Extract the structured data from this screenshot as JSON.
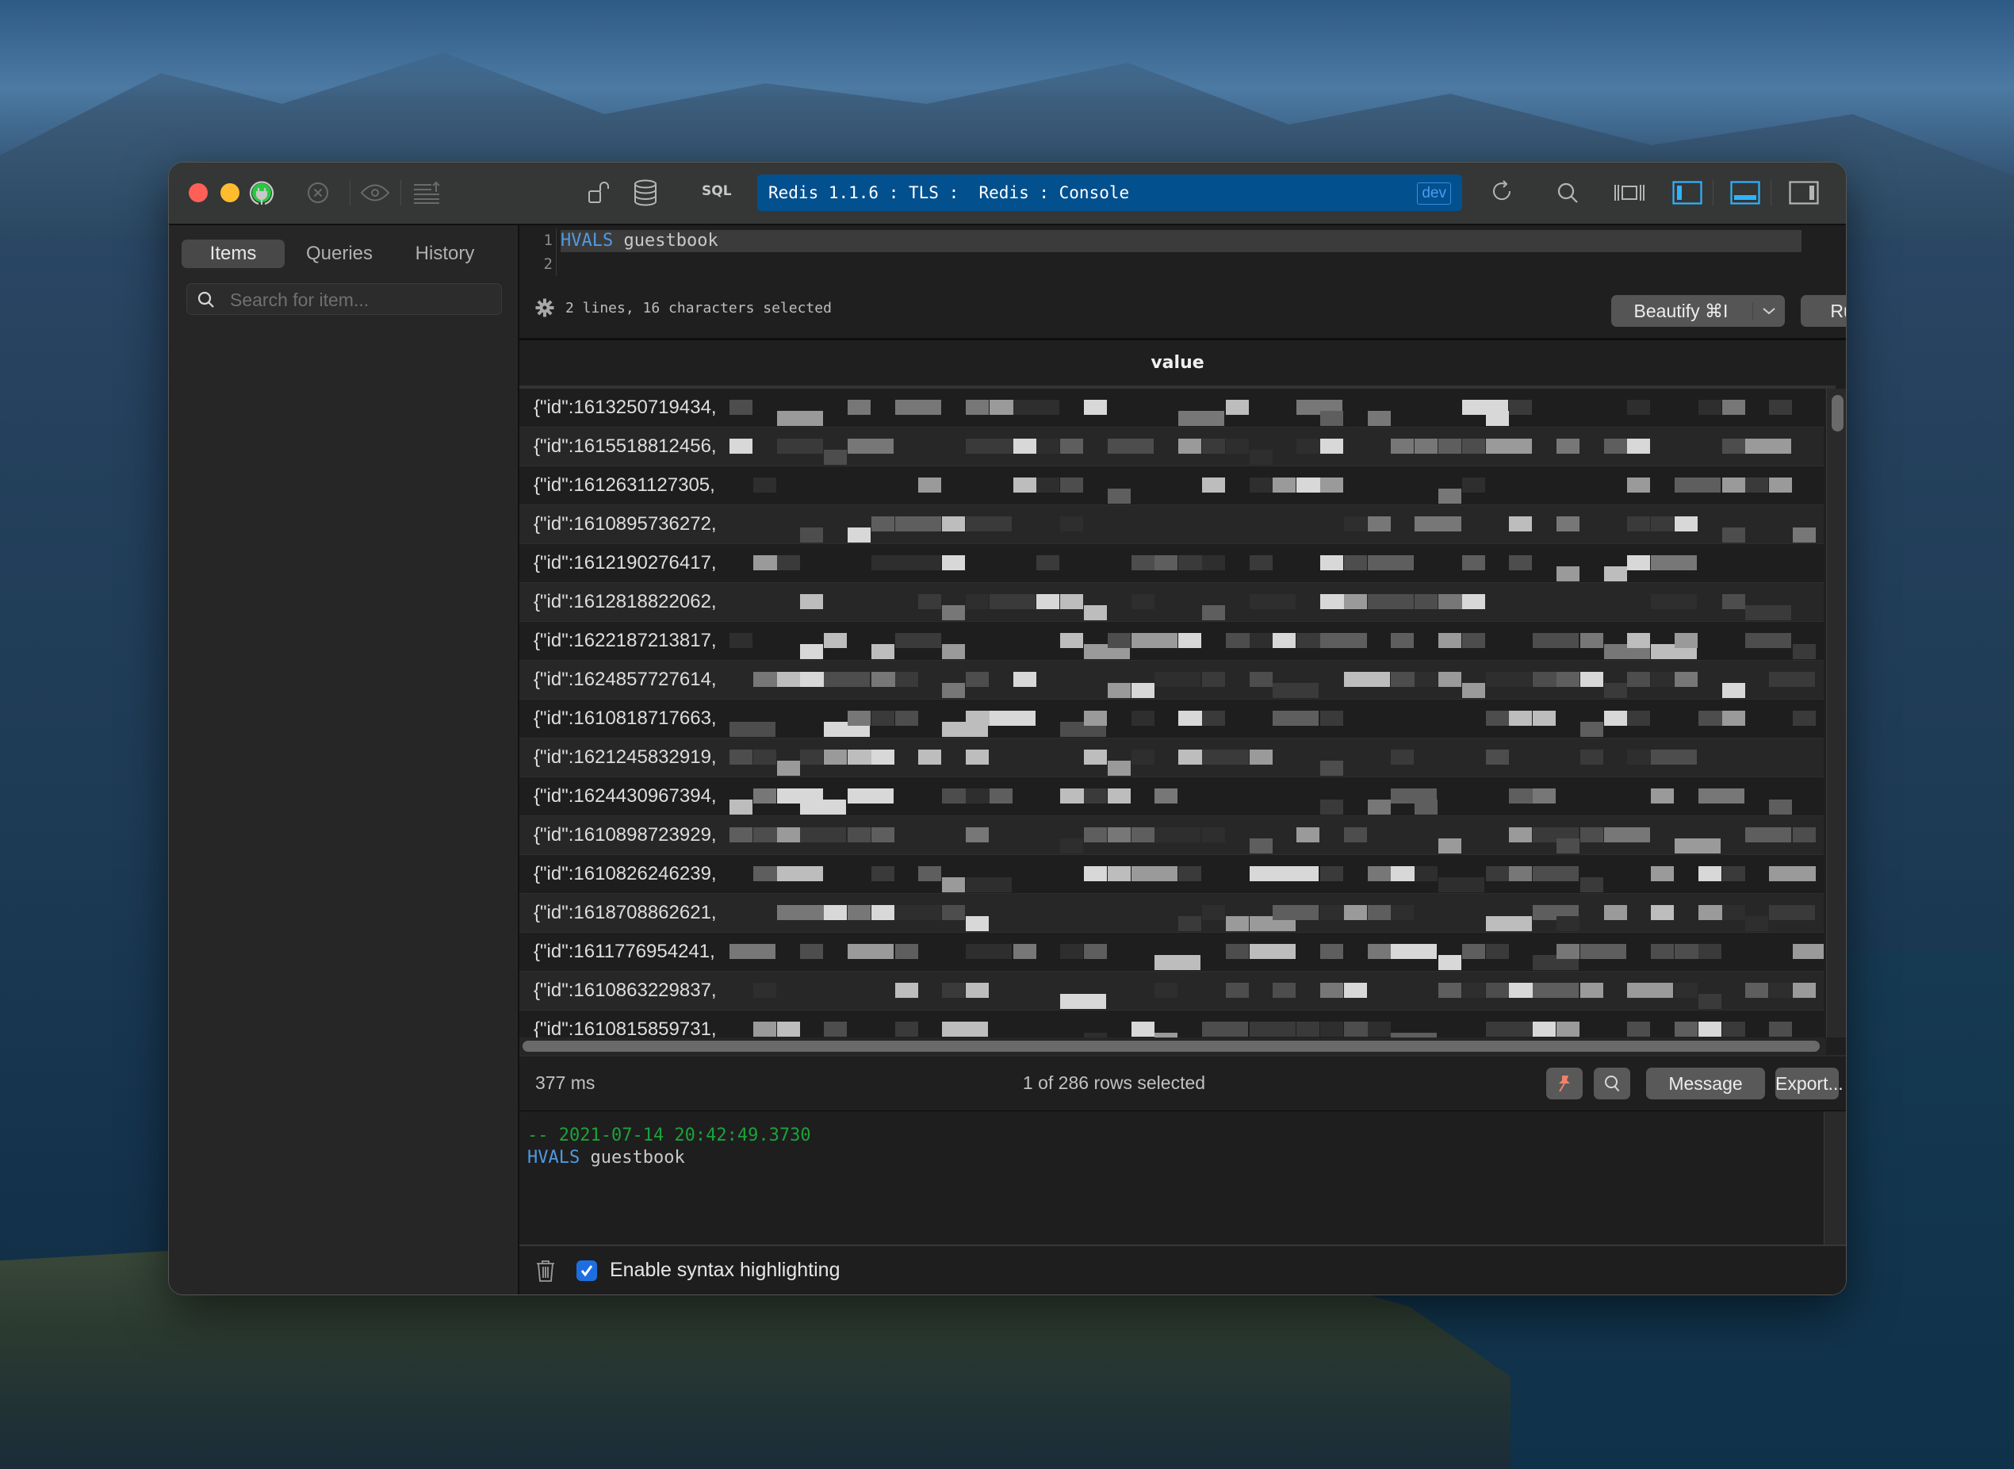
{
  "toolbar": {
    "sql_label": "SQL",
    "connection_title": "Redis 1.1.6 : TLS :  Redis : Console",
    "connection_badge": "dev",
    "accent_color": "#03508f",
    "icons": [
      "plug-icon",
      "stop-icon",
      "eye-icon",
      "commit-icon",
      "lock-icon",
      "database-icon",
      "refresh-icon",
      "search-icon",
      "layout-spread-icon",
      "toggle-left-panel-icon",
      "toggle-bottom-panel-icon",
      "toggle-right-panel-icon"
    ]
  },
  "sidebar": {
    "tabs": [
      {
        "label": "Items",
        "active": true
      },
      {
        "label": "Queries",
        "active": false
      },
      {
        "label": "History",
        "active": false
      }
    ],
    "search_placeholder": "Search for item...",
    "search_value": "",
    "add_label": "+"
  },
  "editor": {
    "line_numbers": [
      "1",
      "2"
    ],
    "lines": [
      {
        "keyword": "HVALS",
        "rest": " guestbook"
      },
      {
        "keyword": "",
        "rest": ""
      }
    ],
    "status": "2 lines, 16 characters selected",
    "beautify_label": "Beautify ⌘I",
    "run_label": "Run Current"
  },
  "results": {
    "column_header": "value",
    "rows": [
      "{\"id\":1613250719434,",
      "{\"id\":1615518812456,",
      "{\"id\":1612631127305,",
      "{\"id\":1610895736272,",
      "{\"id\":1612190276417,",
      "{\"id\":1612818822062,",
      "{\"id\":1622187213817,",
      "{\"id\":1624857727614,",
      "{\"id\":1610818717663,",
      "{\"id\":1621245832919,",
      "{\"id\":1624430967394,",
      "{\"id\":1610898723929,",
      "{\"id\":1610826246239,",
      "{\"id\":1618708862621,",
      "{\"id\":1611776954241,",
      "{\"id\":1610863229837,",
      "{\"id\":1610815859731,"
    ]
  },
  "statusbar": {
    "elapsed": "377 ms",
    "selection": "1 of 286 rows selected",
    "message_label": "Message",
    "export_label": "Export...",
    "pin_color": "#f0826a"
  },
  "console": {
    "timestamp_line": "-- 2021-07-14 20:42:49.3730",
    "command_keyword": "HVALS",
    "command_rest": " guestbook"
  },
  "bottombar": {
    "syntax_highlighting_label": "Enable syntax highlighting",
    "syntax_highlighting_checked": true
  }
}
